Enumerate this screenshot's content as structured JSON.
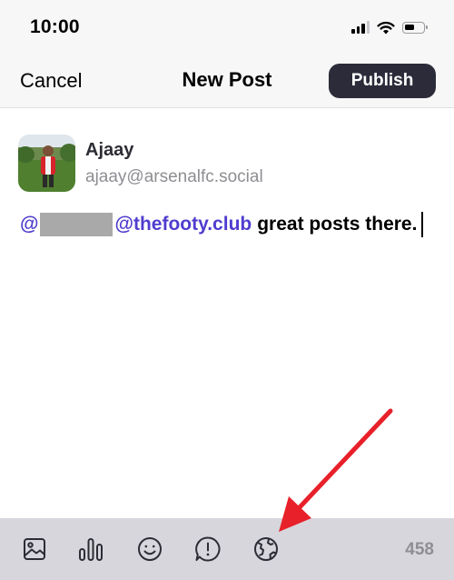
{
  "status_bar": {
    "time": "10:00"
  },
  "nav": {
    "cancel_label": "Cancel",
    "title": "New Post",
    "publish_label": "Publish"
  },
  "account": {
    "name": "Ajaay",
    "handle": "ajaay@arsenalfc.social"
  },
  "compose": {
    "mention_prefix": "@",
    "mention_domain": "@thefooty.club",
    "body": "great posts there."
  },
  "toolbar": {
    "tools": [
      "image-icon",
      "poll-icon",
      "emoji-icon",
      "content-warning-icon",
      "visibility-globe-icon"
    ],
    "char_count": "458"
  },
  "colors": {
    "accent": "#4f3dcf",
    "publish_bg": "#2b2b3a",
    "toolbar_bg": "#d6d6dc",
    "annotation_arrow": "#e8202a"
  }
}
